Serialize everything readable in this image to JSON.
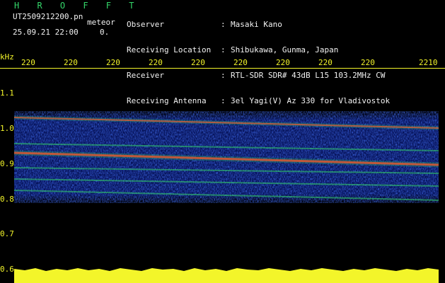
{
  "header": {
    "title": "H R O F F T",
    "file_name": "UT2509212200.pn",
    "meteor_label": "meteor",
    "date_time": "25.09.21 22:00",
    "count": "0."
  },
  "info": [
    {
      "key": "Observer",
      "value": "Masaki Kano"
    },
    {
      "key": "Receiving Location",
      "value": "Shibukawa, Gunma, Japan"
    },
    {
      "key": "Receiver",
      "value": "RTL-SDR SDR# 43dB L15 103.2MHz CW"
    },
    {
      "key": "Receiving Antenna",
      "value": "3el Yagi(V) Az 330 for Vladivostok"
    }
  ],
  "axis": {
    "unit": "kHz",
    "top_ticks": [
      "220",
      "220",
      "220",
      "220",
      "220",
      "220",
      "220",
      "220",
      "220",
      "2210"
    ],
    "y_ticks": [
      "1.1",
      "1.0",
      "0.9",
      "0.8",
      "0.7",
      "0.6"
    ]
  },
  "colors": {
    "label_green": "#34d66a",
    "label_yellow": "#f3f52a",
    "signal_red": "#ff2a2a",
    "noise_blue": "#1030d0"
  }
}
